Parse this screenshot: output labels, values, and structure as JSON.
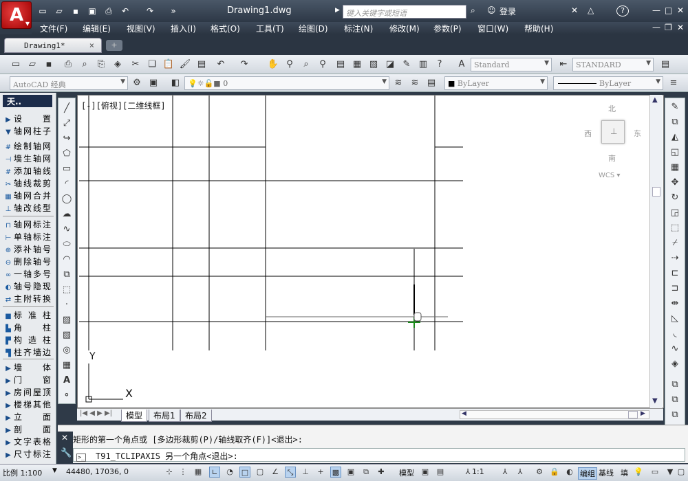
{
  "app": {
    "logo": "A",
    "title": "Drawing1.dwg"
  },
  "titlebar": {
    "search_placeholder": "键入关键字或短语",
    "login": "登录",
    "help": "?"
  },
  "menu": [
    "文件(F)",
    "编辑(E)",
    "视图(V)",
    "插入(I)",
    "格式(O)",
    "工具(T)",
    "绘图(D)",
    "标注(N)",
    "修改(M)",
    "参数(P)",
    "窗口(W)",
    "帮助(H)"
  ],
  "tabs": {
    "document": "Drawing1*",
    "close": "×"
  },
  "toolbar": {
    "text_style": "Standard",
    "dim_style": "STANDARD",
    "workspace": "AutoCAD 经典",
    "layer": "0",
    "color": "ByLayer",
    "linetype": "ByLayer"
  },
  "panel": {
    "title": "天..",
    "items": [
      {
        "label": "设　置",
        "icon": "▶",
        "group": true
      },
      {
        "label": "轴网柱子",
        "icon": "▼",
        "group": true
      },
      {
        "label": "绘制轴网",
        "icon": "#"
      },
      {
        "label": "墙生轴网",
        "icon": "⊣"
      },
      {
        "label": "添加轴线",
        "icon": "#"
      },
      {
        "label": "轴线裁剪",
        "icon": "✂"
      },
      {
        "label": "轴网合并",
        "icon": "▦"
      },
      {
        "label": "轴改线型",
        "icon": "⊥"
      },
      {
        "label": "轴网标注",
        "icon": "⊓"
      },
      {
        "label": "单轴标注",
        "icon": "⊢"
      },
      {
        "label": "添补轴号",
        "icon": "⊕"
      },
      {
        "label": "删除轴号",
        "icon": "⊖"
      },
      {
        "label": "一轴多号",
        "icon": "∞"
      },
      {
        "label": "轴号隐现",
        "icon": "◐"
      },
      {
        "label": "主附转换",
        "icon": "⇄"
      },
      {
        "label": "标准柱",
        "icon": "■"
      },
      {
        "label": "角　柱",
        "icon": "▙"
      },
      {
        "label": "构造柱",
        "icon": "▛"
      },
      {
        "label": "柱齐墙边",
        "icon": "▜"
      },
      {
        "label": "墙　体",
        "icon": "▶",
        "group": true
      },
      {
        "label": "门　窗",
        "icon": "▶",
        "group": true
      },
      {
        "label": "房间屋顶",
        "icon": "▶",
        "group": true
      },
      {
        "label": "楼梯其他",
        "icon": "▶",
        "group": true
      },
      {
        "label": "立　面",
        "icon": "▶",
        "group": true
      },
      {
        "label": "剖　面",
        "icon": "▶",
        "group": true
      },
      {
        "label": "文字表格",
        "icon": "▶",
        "group": true
      },
      {
        "label": "尺寸标注",
        "icon": "▶",
        "group": true
      }
    ]
  },
  "viewport": {
    "label": "[-][俯视][二维线框]"
  },
  "compass": {
    "north": "北",
    "south": "南",
    "east": "东",
    "west": "西",
    "wcs": "WCS"
  },
  "ucs": {
    "y": "Y",
    "x": "X"
  },
  "layout_tabs": [
    "模型",
    "布局1",
    "布局2"
  ],
  "command": {
    "history": "矩形的第一个角点或 [多边形裁剪(P)/轴线取齐(F)]<退出>:",
    "prompt": "T91_TCLIPAXIS 另一个角点<退出>:"
  },
  "status": {
    "scale": "比例 1:100",
    "coords": "44480, 17036, 0",
    "model": "模型",
    "annotation_scale": "1:1",
    "edit_group": "编组",
    "baseline": "基线",
    "fill": "填"
  },
  "colors": {
    "accent": "#2b3542",
    "panel_title": "#1c2c4a",
    "logo": "#c81818"
  }
}
